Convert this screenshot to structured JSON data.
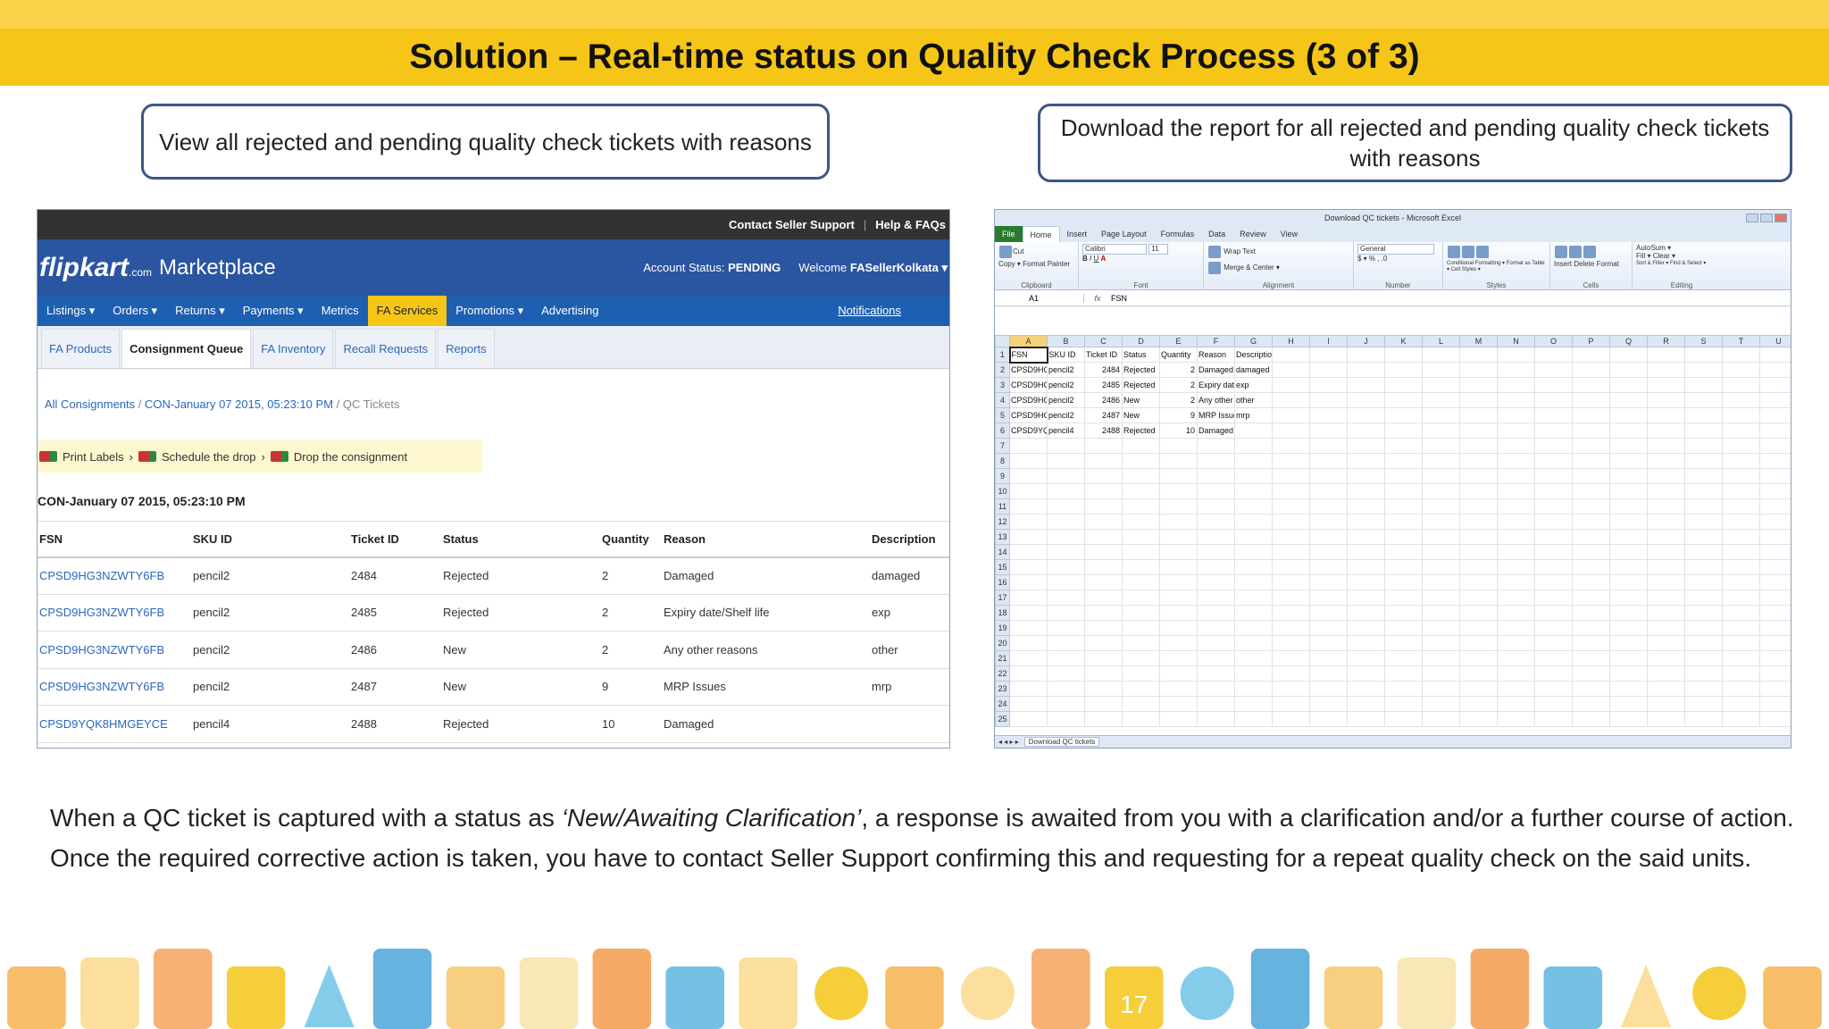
{
  "slide": {
    "title": "Solution – Real-time status on Quality Check Process (3 of 3)",
    "callout_left": "View all rejected and pending quality check tickets with reasons",
    "callout_right": "Download the report for all rejected and pending quality check tickets with reasons",
    "body_before": "When a QC ticket is captured with a status as ",
    "body_italic": "‘New/Awaiting Clarification’",
    "body_after": ", a response is awaited from you with a clarification and/or a further course of action. Once the required corrective action is taken, you have to contact Seller Support confirming this and requesting for a repeat quality check on the said units."
  },
  "flipkart": {
    "top_links": [
      "Contact Seller Support",
      "Help & FAQs"
    ],
    "logo": "flipkart",
    "logo_suffix": ".com",
    "marketplace": "Marketplace",
    "account_status_label": "Account Status:",
    "account_status": "PENDING",
    "welcome": "Welcome",
    "user": "FASellerKolkata ▾",
    "nav": [
      "Listings ▾",
      "Orders ▾",
      "Returns ▾",
      "Payments ▾",
      "Metrics",
      "FA Services",
      "Promotions ▾",
      "Advertising"
    ],
    "nav_active_index": 5,
    "notifications": "Notifications",
    "tabs": [
      "FA Products",
      "Consignment Queue",
      "FA Inventory",
      "Recall Requests",
      "Reports"
    ],
    "tab_active_index": 1,
    "breadcrumb": [
      "All Consignments",
      "CON-January 07 2015, 05:23:10 PM",
      "QC Tickets"
    ],
    "steps": [
      "Print Labels",
      "Schedule the drop",
      "Drop the consignment"
    ],
    "consignment": "CON-January 07 2015, 05:23:10 PM",
    "columns": [
      "FSN",
      "SKU ID",
      "Ticket ID",
      "Status",
      "Quantity",
      "Reason",
      "Description"
    ],
    "rows": [
      [
        "CPSD9HG3NZWTY6FB",
        "pencil2",
        "2484",
        "Rejected",
        "2",
        "Damaged",
        "damaged"
      ],
      [
        "CPSD9HG3NZWTY6FB",
        "pencil2",
        "2485",
        "Rejected",
        "2",
        "Expiry date/Shelf life",
        "exp"
      ],
      [
        "CPSD9HG3NZWTY6FB",
        "pencil2",
        "2486",
        "New",
        "2",
        "Any other reasons",
        "other"
      ],
      [
        "CPSD9HG3NZWTY6FB",
        "pencil2",
        "2487",
        "New",
        "9",
        "MRP Issues",
        "mrp"
      ],
      [
        "CPSD9YQK8HMGEYCE",
        "pencil4",
        "2488",
        "Rejected",
        "10",
        "Damaged",
        ""
      ]
    ]
  },
  "excel": {
    "window_title": "Download QC tickets - Microsoft Excel",
    "ribbon_tabs": [
      "File",
      "Home",
      "Insert",
      "Page Layout",
      "Formulas",
      "Data",
      "Review",
      "View"
    ],
    "groups": [
      "Clipboard",
      "Font",
      "Alignment",
      "Number",
      "Styles",
      "Cells",
      "Editing"
    ],
    "clipboard": [
      "Cut",
      "Copy ▾",
      "Format Painter",
      "Paste"
    ],
    "font_name": "Calibri",
    "font_size": "11",
    "wrap_text": "Wrap Text",
    "merge_center": "Merge & Center ▾",
    "number_format": "General",
    "styles": [
      "Conditional Formatting ▾",
      "Format as Table ▾",
      "Cell Styles ▾"
    ],
    "cells": [
      "Insert",
      "Delete",
      "Format"
    ],
    "editing": [
      "AutoSum ▾",
      "Fill ▾",
      "Clear ▾",
      "Sort & Filter ▾",
      "Find & Select ▾"
    ],
    "name_box": "A1",
    "fx": "fx",
    "formula": "FSN",
    "col_letters": [
      "A",
      "B",
      "C",
      "D",
      "E",
      "F",
      "G",
      "H",
      "I",
      "J",
      "K",
      "L",
      "M",
      "N",
      "O",
      "P",
      "Q",
      "R",
      "S",
      "T",
      "U"
    ],
    "header_row": [
      "FSN",
      "SKU ID",
      "Ticket ID",
      "Status",
      "Quantity",
      "Reason",
      "Description"
    ],
    "data_rows": [
      [
        "CPSD9HG3",
        "pencil2",
        "2484",
        "Rejected",
        "2",
        "Damaged",
        "damaged"
      ],
      [
        "CPSD9HG3",
        "pencil2",
        "2485",
        "Rejected",
        "2",
        "Expiry dat",
        "exp"
      ],
      [
        "CPSD9HG3",
        "pencil2",
        "2486",
        "New",
        "2",
        "Any other",
        "other"
      ],
      [
        "CPSD9HG3",
        "pencil2",
        "2487",
        "New",
        "9",
        "MRP Issue",
        "mrp"
      ],
      [
        "CPSD9YQK",
        "pencil4",
        "2488",
        "Rejected",
        "10",
        "Damaged",
        ""
      ]
    ],
    "row_count": 25,
    "sheet_name": "Download QC tickets"
  },
  "decor_icons": [
    "calculator-icon",
    "gift-icon",
    "camera-icon",
    "truck-icon",
    "cone-icon",
    "suitcase-icon",
    "ipod-icon",
    "phone-icon",
    "calculator-icon",
    "projector-icon",
    "printer-icon",
    "alarm-clock-icon",
    "headphones-icon",
    "sun-icon",
    "book-icon",
    "calendar-icon",
    "target-icon",
    "binoculars-icon",
    "monitor-icon",
    "gift-icon",
    "camera-icon",
    "truck-icon",
    "cone-icon",
    "alarm-clock-icon",
    "headphones-icon"
  ],
  "decor_calendar": "17"
}
